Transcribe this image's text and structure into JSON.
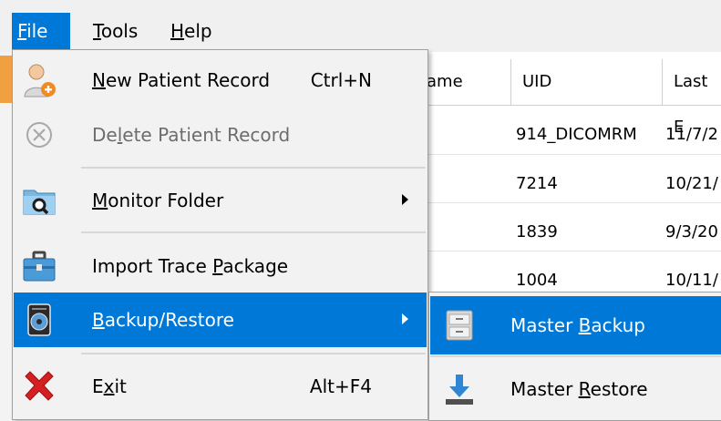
{
  "menubar": {
    "items": [
      {
        "label": "File",
        "accel": "F",
        "rest": "ile"
      },
      {
        "label": "Tools",
        "accel": "T",
        "rest": "ools"
      },
      {
        "label": "Help",
        "accel": "H",
        "rest": "elp"
      }
    ]
  },
  "table": {
    "columns": [
      "ame",
      "UID",
      "Last E"
    ],
    "rows": [
      {
        "uid": "914_DICOMRM",
        "last": "11/7/2"
      },
      {
        "uid": "7214",
        "last": "10/21/"
      },
      {
        "uid": "1839",
        "last": "9/3/20"
      },
      {
        "uid": "1004",
        "last": "10/11/"
      }
    ]
  },
  "file_menu": {
    "new_patient": {
      "pre": "",
      "accel": "N",
      "post": "ew Patient Record",
      "shortcut": "Ctrl+N",
      "icon": "person-add-icon"
    },
    "delete_patient": {
      "pre": "De",
      "accel": "l",
      "post": "ete Patient Record",
      "icon": "delete-circle-icon"
    },
    "monitor_folder": {
      "pre": "",
      "accel": "M",
      "post": "onitor Folder",
      "icon": "folder-search-icon"
    },
    "import_trace": {
      "pre": "Import Trace ",
      "accel": "P",
      "post": "ackage",
      "icon": "briefcase-icon"
    },
    "backup_restore": {
      "pre": "",
      "accel": "B",
      "post": "ackup/Restore",
      "icon": "disk-drive-icon"
    },
    "exit": {
      "pre": "E",
      "accel": "x",
      "post": "it",
      "shortcut": "Alt+F4",
      "icon": "red-x-icon"
    }
  },
  "submenu": {
    "master_backup": {
      "pre": "Master ",
      "accel": "B",
      "post": "ackup",
      "icon": "cabinet-icon"
    },
    "master_restore": {
      "pre": "Master ",
      "accel": "R",
      "post": "estore",
      "icon": "download-tray-icon"
    }
  },
  "colors": {
    "highlight": "#0078d7",
    "menu_bg": "#f2f2f2",
    "accent_orange": "#f0a040",
    "exit_red": "#d42020"
  }
}
